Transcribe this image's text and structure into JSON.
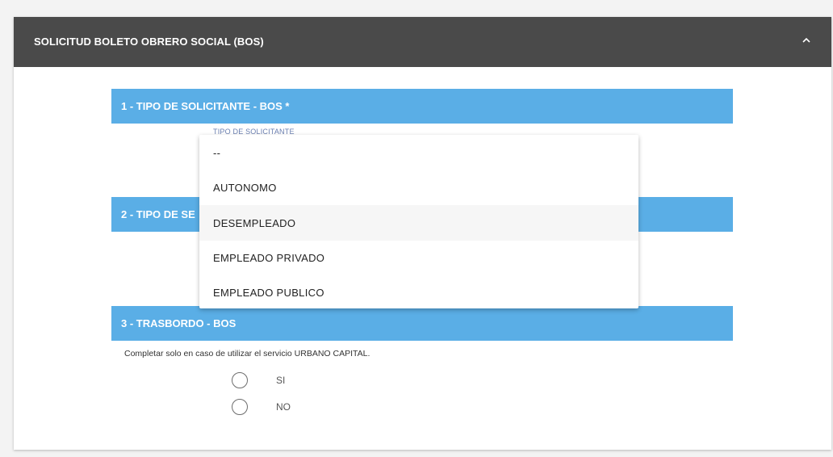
{
  "panel": {
    "title": "SOLICITUD BOLETO OBRERO SOCIAL (BOS)"
  },
  "sections": [
    {
      "label": "1 - TIPO DE SOLICITANTE - BOS *"
    },
    {
      "label": "2 - TIPO DE SE"
    },
    {
      "label": "3 - TRASBORDO - BOS"
    }
  ],
  "solicitante_field": {
    "label": "TIPO DE SOLICITANTE"
  },
  "dropdown": {
    "options": [
      "--",
      "AUTONOMO",
      "DESEMPLEADO",
      "EMPLEADO PRIVADO",
      "EMPLEADO PUBLICO"
    ],
    "highlighted": "DESEMPLEADO"
  },
  "trasbordo": {
    "helper_text": "Completar solo en caso de utilizar el servicio URBANO CAPITAL.",
    "options": [
      "SI",
      "NO"
    ]
  },
  "colors": {
    "header_bg": "#4a4a4a",
    "section_bg": "#5aaee6"
  }
}
